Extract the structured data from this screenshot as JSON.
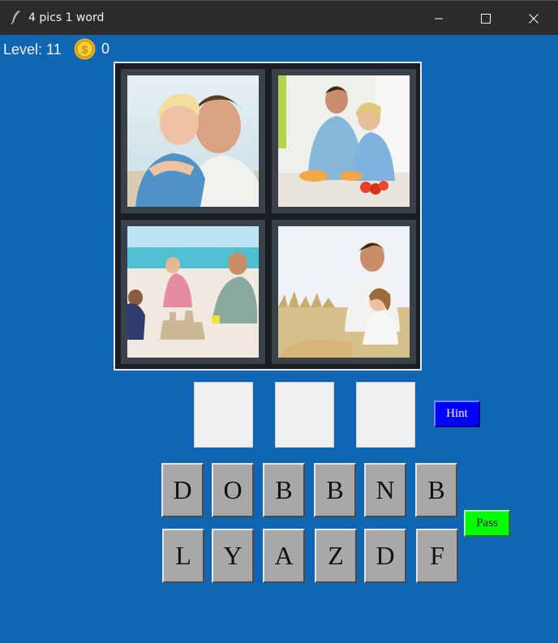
{
  "window": {
    "title": "4 pics 1 word",
    "controls": [
      "minimize-icon",
      "maximize-icon",
      "close-icon"
    ]
  },
  "status": {
    "level_label": "Level: 11",
    "coins": "0",
    "coin_icon": "coin-icon"
  },
  "puzzle": {
    "images": [
      "father-son-beach-photo",
      "father-son-kitchen-photo",
      "family-sandcastle-photo",
      "father-daughter-grass-photo"
    ],
    "answer_slots": [
      "",
      "",
      ""
    ]
  },
  "buttons": {
    "hint": "Hint",
    "pass": "Pass"
  },
  "letters": {
    "row1": [
      "D",
      "O",
      "B",
      "B",
      "N",
      "B"
    ],
    "row2": [
      "L",
      "Y",
      "A",
      "Z",
      "D",
      "F"
    ]
  },
  "colors": {
    "background": "#1066b2",
    "hint": "#0000ff",
    "pass": "#00ff00",
    "tile": "#a8a8a8"
  }
}
